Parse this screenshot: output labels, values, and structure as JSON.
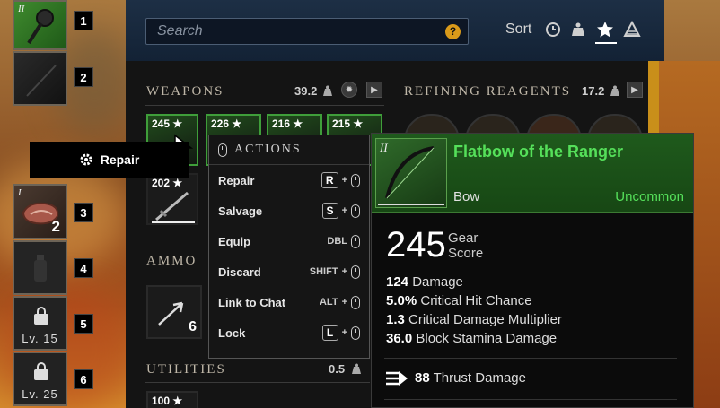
{
  "quickbar": {
    "slots": [
      {
        "num": "1",
        "tier": "II"
      },
      {
        "num": "2"
      },
      {
        "num": "3",
        "tier": "I",
        "count": "2"
      },
      {
        "num": "4"
      },
      {
        "num": "5",
        "lock": "Lv. 15"
      },
      {
        "num": "6",
        "lock": "Lv. 25"
      }
    ]
  },
  "repair_tip": {
    "label": "Repair",
    "icon": "gear-icon"
  },
  "search": {
    "placeholder": "Search",
    "help": "?"
  },
  "sort": {
    "label": "Sort",
    "icons": [
      "clock-icon",
      "weight-icon",
      "star-icon",
      "tier-icon"
    ]
  },
  "weapons": {
    "title": "WEAPONS",
    "weight": "39.2",
    "items": [
      {
        "gs": "245"
      },
      {
        "gs": "226"
      },
      {
        "gs": "216"
      },
      {
        "gs": "215"
      },
      {
        "gs": "202"
      }
    ]
  },
  "ammo": {
    "title": "AMMO",
    "count": "6"
  },
  "utilities": {
    "title": "UTILITIES",
    "weight": "0.5",
    "items": [
      {
        "gs": "100"
      }
    ]
  },
  "refining": {
    "title": "REFINING REAGENTS",
    "weight": "17.2"
  },
  "actions": {
    "title": "ACTIONS",
    "rows": [
      {
        "label": "Repair",
        "key": "R"
      },
      {
        "label": "Salvage",
        "key": "S"
      },
      {
        "label": "Equip",
        "key": "DBL"
      },
      {
        "label": "Discard",
        "key": "SHIFT"
      },
      {
        "label": "Link to Chat",
        "key": "ALT"
      },
      {
        "label": "Lock",
        "key": "L"
      }
    ]
  },
  "tooltip": {
    "tier": "II",
    "name": "Flatbow of the Ranger",
    "type": "Bow",
    "rarity": "Uncommon",
    "gear_score": "245",
    "gear_label_1": "Gear",
    "gear_label_2": "Score",
    "stats": [
      {
        "value": "124",
        "label": "Damage"
      },
      {
        "value": "5.0%",
        "label": "Critical Hit Chance"
      },
      {
        "value": "1.3",
        "label": "Critical Damage Multiplier"
      },
      {
        "value": "36.0",
        "label": "Block Stamina Damage"
      }
    ],
    "thrust": {
      "value": "88",
      "label": "Thrust Damage"
    }
  },
  "colors": {
    "uncommon": "#55e05a",
    "accent": "#d99a1a"
  }
}
